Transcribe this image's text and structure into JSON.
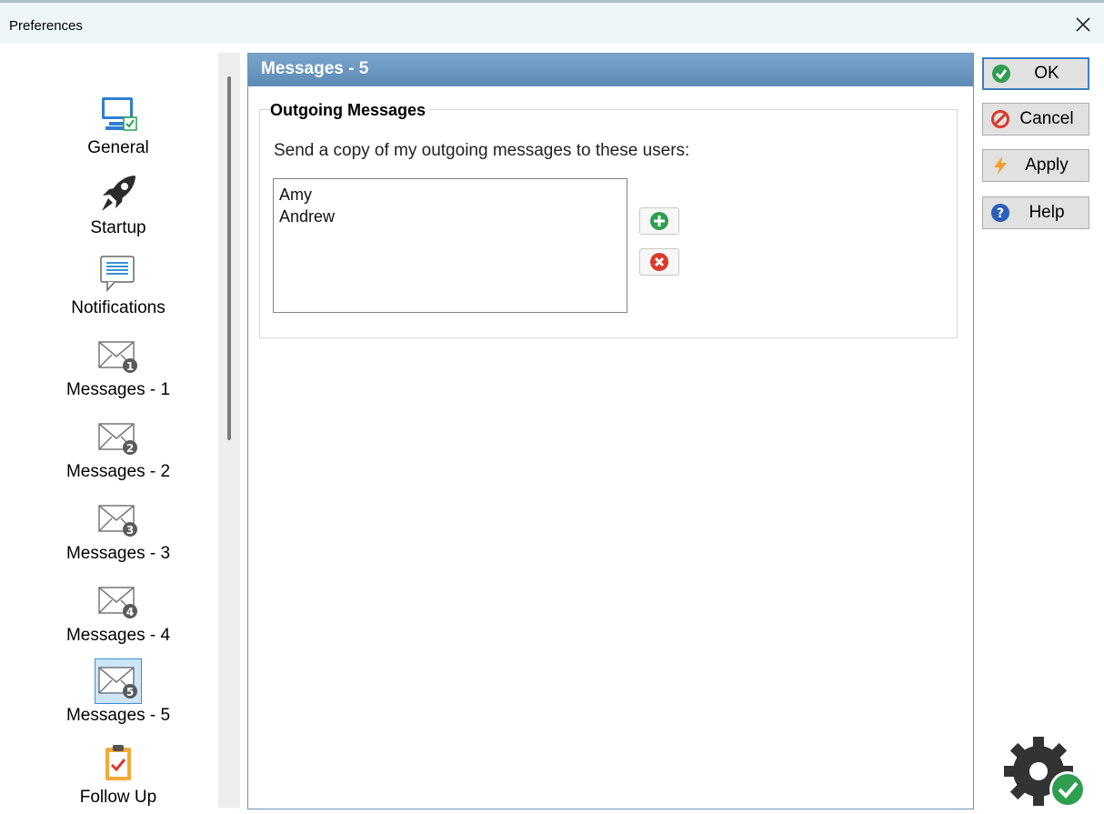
{
  "window": {
    "title": "Preferences"
  },
  "sidebar": {
    "items": [
      {
        "label": "General",
        "icon": "monitor-check-icon"
      },
      {
        "label": "Startup",
        "icon": "rocket-icon"
      },
      {
        "label": "Notifications",
        "icon": "notification-speech-icon"
      },
      {
        "label": "Messages - 1",
        "icon": "envelope-1-icon",
        "badge": "1"
      },
      {
        "label": "Messages - 2",
        "icon": "envelope-2-icon",
        "badge": "2"
      },
      {
        "label": "Messages - 3",
        "icon": "envelope-3-icon",
        "badge": "3"
      },
      {
        "label": "Messages - 4",
        "icon": "envelope-4-icon",
        "badge": "4"
      },
      {
        "label": "Messages - 5",
        "icon": "envelope-5-icon",
        "badge": "5",
        "selected": true
      },
      {
        "label": "Follow Up",
        "icon": "clipboard-check-icon"
      }
    ]
  },
  "panel": {
    "header": "Messages - 5",
    "group_title": "Outgoing Messages",
    "description": "Send a copy of my outgoing messages to these users:",
    "users": [
      "Amy",
      "Andrew"
    ]
  },
  "buttons": {
    "ok": "OK",
    "cancel": "Cancel",
    "apply": "Apply",
    "help": "Help"
  },
  "colors": {
    "header_bg": "#6a96bf",
    "ok_green": "#2e9e4f",
    "cancel_red": "#d93a2b",
    "apply_orange": "#f0a030",
    "help_blue": "#2b5fb8",
    "selected_bg": "#cde5f7"
  }
}
